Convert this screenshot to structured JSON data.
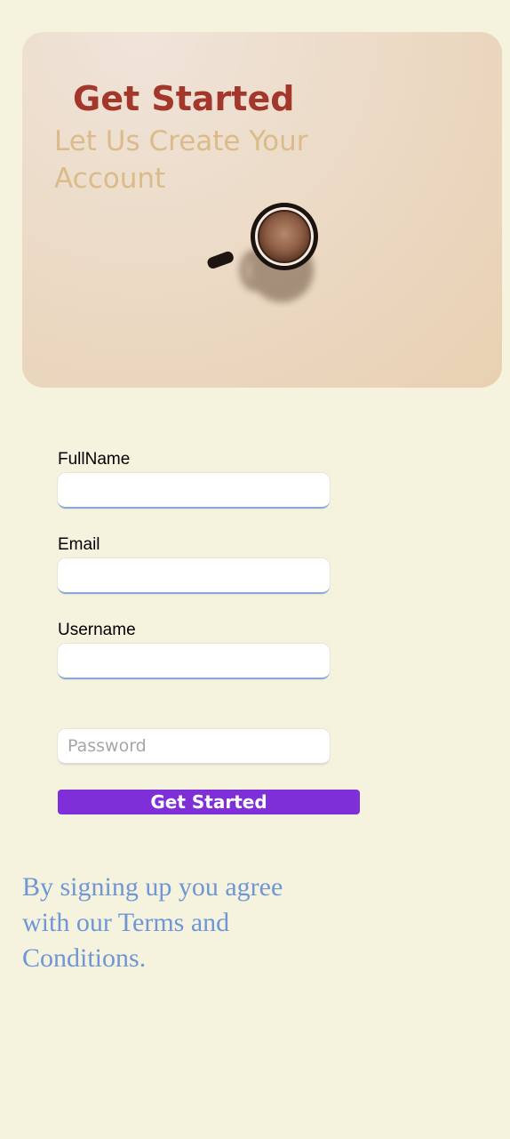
{
  "hero": {
    "title": "Get Started",
    "subtitle": "Let Us Create Your Account"
  },
  "form": {
    "fullname_label": "FullName",
    "email_label": "Email",
    "username_label": "Username",
    "password_placeholder": "Password",
    "fullname_value": "",
    "email_value": "",
    "username_value": "",
    "submit_label": "Get Started"
  },
  "footer": {
    "terms_text": "By signing up you agree with our Terms and Conditions."
  },
  "colors": {
    "page_background": "#f5f3de",
    "title": "#a3372c",
    "subtitle": "#dcbb8a",
    "button": "#7e2fd8",
    "terms_text": "#6f96d6"
  },
  "icons": {
    "hero_image": "coffee-cup-image"
  }
}
